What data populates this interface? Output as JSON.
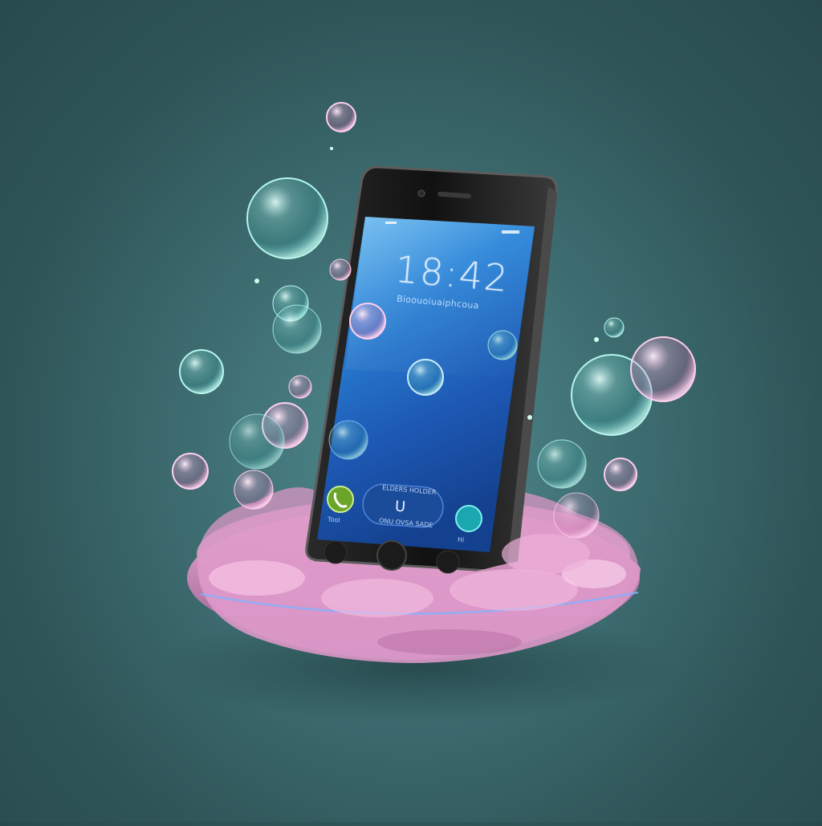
{
  "phone": {
    "clock": "18:42",
    "subline": "Bioouoiuaiphcoua",
    "call_pill_top": "ELDERS HOLDER",
    "call_pill_symbol": "U",
    "call_pill_bottom": "ONU OVSA SADE",
    "left_small_label": "Tool",
    "right_small_label": "Hi"
  },
  "colors": {
    "background": "#3f6f73",
    "phone_screen": "#1e6fd0",
    "phone_body": "#151515",
    "dish": "#d48ab8",
    "accept_button": "#6aa52a",
    "teal_button": "#1aa7b0"
  },
  "icons": [
    "phone-accept-icon",
    "camera-icon",
    "speaker-icon",
    "home-button-icon"
  ]
}
